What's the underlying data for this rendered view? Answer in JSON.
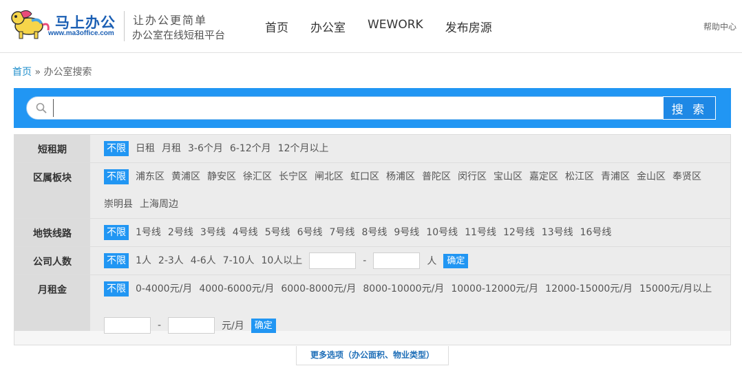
{
  "header": {
    "logo_text": "马上办公",
    "logo_url": "www.ma3office.com",
    "slogan": "让办公更简单",
    "platform": "办公室在线短租平台",
    "nav": [
      "首页",
      "办公室",
      "WEWORK",
      "发布房源"
    ],
    "help": "帮助中心"
  },
  "breadcrumb": {
    "home": "首页",
    "sep": " » ",
    "current": "办公室搜索"
  },
  "search": {
    "button": "搜 索",
    "value": ""
  },
  "filters": {
    "lease_term": {
      "label": "短租期",
      "options": [
        "不限",
        "日租",
        "月租",
        "3-6个月",
        "6-12个月",
        "12个月以上"
      ]
    },
    "district": {
      "label": "区属板块",
      "options": [
        "不限",
        "浦东区",
        "黄浦区",
        "静安区",
        "徐汇区",
        "长宁区",
        "闸北区",
        "虹口区",
        "杨浦区",
        "普陀区",
        "闵行区",
        "宝山区",
        "嘉定区",
        "松江区",
        "青浦区",
        "金山区",
        "奉贤区",
        "崇明县",
        "上海周边"
      ]
    },
    "metro": {
      "label": "地铁线路",
      "options": [
        "不限",
        "1号线",
        "2号线",
        "3号线",
        "4号线",
        "5号线",
        "6号线",
        "7号线",
        "8号线",
        "9号线",
        "10号线",
        "11号线",
        "12号线",
        "13号线",
        "16号线"
      ]
    },
    "company_size": {
      "label": "公司人数",
      "options": [
        "不限",
        "1人",
        "2-3人",
        "4-6人",
        "7-10人",
        "10人以上"
      ],
      "range_sep": "-",
      "unit": "人",
      "confirm": "确定"
    },
    "rent": {
      "label": "月租金",
      "options": [
        "不限",
        "0-4000元/月",
        "4000-6000元/月",
        "6000-8000元/月",
        "8000-10000元/月",
        "10000-12000元/月",
        "12000-15000元/月",
        "15000元/月以上"
      ],
      "range_sep": "-",
      "unit": "元/月",
      "confirm": "确定"
    }
  },
  "more_options": "更多选项（办公面积、物业类型）",
  "colors": {
    "accent": "#2196f3",
    "link": "#1f8ecb",
    "brand": "#1b5fb4"
  }
}
